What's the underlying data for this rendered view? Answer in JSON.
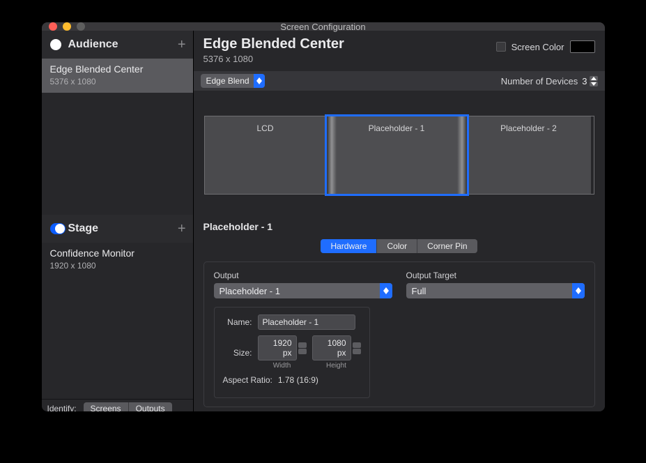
{
  "window": {
    "title": "Screen Configuration"
  },
  "sidebar": {
    "audience": {
      "label": "Audience",
      "item": {
        "name": "Edge Blended Center",
        "dim": "5376 x 1080"
      }
    },
    "stage": {
      "label": "Stage",
      "item": {
        "name": "Confidence Monitor",
        "dim": "1920 x 1080"
      }
    },
    "identify": {
      "label": "Identify:",
      "screens": "Screens",
      "outputs": "Outputs"
    }
  },
  "main": {
    "title": "Edge Blended Center",
    "subtitle": "5376 x 1080",
    "screencolor_label": "Screen Color",
    "mode": "Edge Blend",
    "devices_label": "Number of Devices",
    "devices_count": "3",
    "screens": {
      "a": "LCD",
      "b": "Placeholder - 1",
      "c": "Placeholder - 2"
    }
  },
  "detail": {
    "title": "Placeholder - 1",
    "tabs": {
      "hardware": "Hardware",
      "color": "Color",
      "corner": "Corner Pin"
    },
    "output_label": "Output",
    "output_value": "Placeholder - 1",
    "target_label": "Output Target",
    "target_value": "Full",
    "name_label": "Name:",
    "name_value": "Placeholder - 1",
    "size_label": "Size:",
    "width_value": "1920 px",
    "width_label": "Width",
    "height_value": "1080 px",
    "height_label": "Height",
    "aspect_label": "Aspect Ratio:",
    "aspect_value": "1.78 (16:9)"
  }
}
